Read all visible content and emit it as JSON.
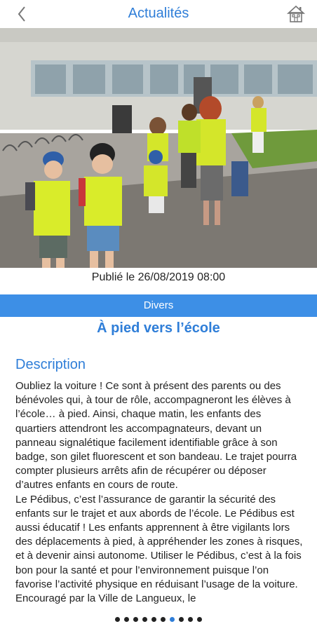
{
  "header": {
    "title": "Actualités",
    "back_icon": "chevron-left-icon",
    "home_icon": "home-icon"
  },
  "article": {
    "image_icon": "photo-children-walking",
    "published": "Publié le 26/08/2019 08:00",
    "category": "Divers",
    "title": "À pied vers l’école",
    "description_heading": "Description",
    "description": "Oubliez la voiture ! Ce sont à présent des parents ou des bénévoles qui, à tour de rôle, accompagneront les élèves à l’école… à pied. Ainsi, chaque matin, les enfants des quartiers attendront les accompagnateurs, devant un panneau signalétique facilement identifiable grâce à son badge, son gilet fluorescent et son bandeau. Le trajet pourra compter plusieurs arrêts afin de récupérer ou déposer d’autres enfants en cours de route.\nLe Pédibus, c’est l’assurance de garantir la sécurité des enfants sur le trajet et aux abords de l’école. Le Pédibus est aussi éducatif ! Les enfants apprennent à être vigilants lors des déplacements à pied, à appréhender les zones à risques, et à devenir ainsi autonome. Utiliser le Pédibus, c’est à la fois bon pour la santé et pour l’environnement puisque l’on favorise l’activité physique en réduisant l’usage de la voiture. Encouragé par la Ville de Langueux, le"
  },
  "pager": {
    "count": 10,
    "active_index": 6
  },
  "colors": {
    "accent": "#2f7ed8",
    "category_bar": "#3d8fe6"
  }
}
